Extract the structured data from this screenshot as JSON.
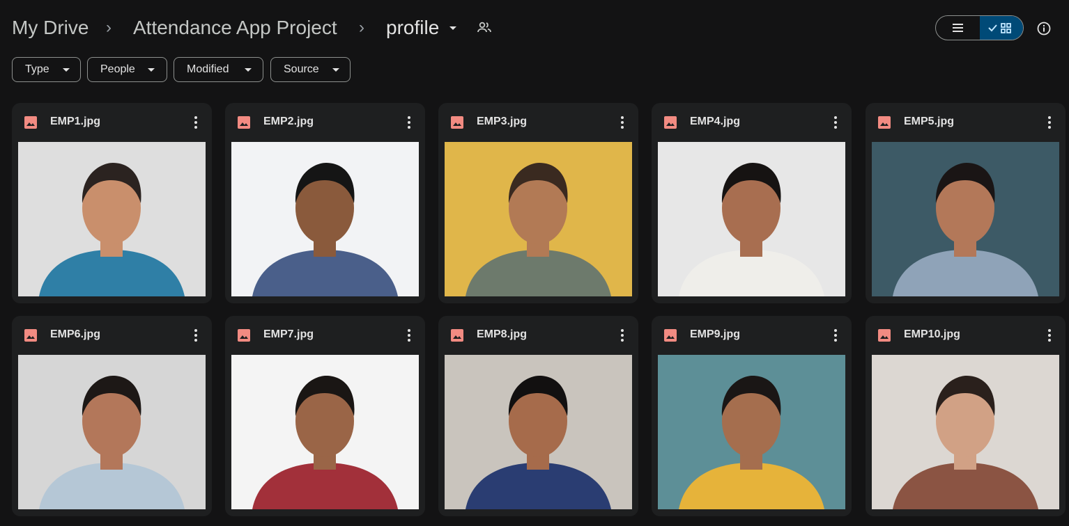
{
  "breadcrumb": {
    "items": [
      "My Drive",
      "Attendance App Project",
      "profile"
    ],
    "separator": "›"
  },
  "header": {
    "share_icon": "people-icon",
    "view_list_icon": "list-icon",
    "view_grid_icon": "grid-check-icon",
    "info_icon": "info-icon"
  },
  "filters": [
    {
      "label": "Type"
    },
    {
      "label": "People"
    },
    {
      "label": "Modified"
    },
    {
      "label": "Source"
    }
  ],
  "files": [
    {
      "name": "EMP1.jpg",
      "icon": "image-file-icon"
    },
    {
      "name": "EMP2.jpg",
      "icon": "image-file-icon"
    },
    {
      "name": "EMP3.jpg",
      "icon": "image-file-icon"
    },
    {
      "name": "EMP4.jpg",
      "icon": "image-file-icon"
    },
    {
      "name": "EMP5.jpg",
      "icon": "image-file-icon"
    },
    {
      "name": "EMP6.jpg",
      "icon": "image-file-icon"
    },
    {
      "name": "EMP7.jpg",
      "icon": "image-file-icon"
    },
    {
      "name": "EMP8.jpg",
      "icon": "image-file-icon"
    },
    {
      "name": "EMP9.jpg",
      "icon": "image-file-icon"
    },
    {
      "name": "EMP10.jpg",
      "icon": "image-file-icon"
    }
  ],
  "colors": {
    "background": "#131314",
    "card": "#1e1f20",
    "accent_selected": "#004a77",
    "image_icon": "#f28b82"
  }
}
